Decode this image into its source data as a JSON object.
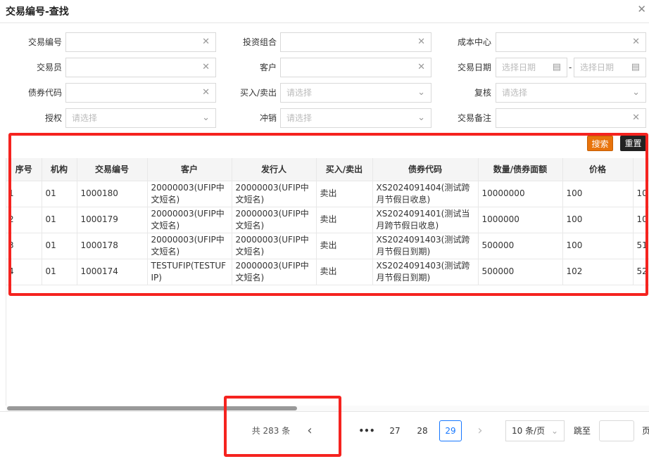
{
  "dialog": {
    "title": "交易编号-查找",
    "close_icon": "close-icon"
  },
  "form": {
    "trade_no": {
      "label": "交易编号",
      "value": ""
    },
    "portfolio": {
      "label": "投资组合",
      "value": ""
    },
    "cost_center": {
      "label": "成本中心",
      "value": ""
    },
    "trader": {
      "label": "交易员",
      "value": ""
    },
    "customer": {
      "label": "客户",
      "value": ""
    },
    "trade_date": {
      "label": "交易日期",
      "start_placeholder": "选择日期",
      "end_placeholder": "选择日期",
      "separator": "-"
    },
    "bond_code": {
      "label": "债券代码",
      "value": ""
    },
    "buy_sell": {
      "label": "买入/卖出",
      "placeholder": "请选择"
    },
    "review": {
      "label": "复核",
      "placeholder": "请选择"
    },
    "authorize": {
      "label": "授权",
      "placeholder": "请选择"
    },
    "offset": {
      "label": "冲销",
      "placeholder": "请选择"
    },
    "remark": {
      "label": "交易备注",
      "value": ""
    },
    "search_label": "搜索",
    "reset_label": "重置",
    "search_color": "#e8730c",
    "reset_color": "#222222"
  },
  "table": {
    "columns": [
      "序号",
      "机构",
      "交易编号",
      "客户",
      "发行人",
      "买入/卖出",
      "债券代码",
      "数量/债券面额",
      "价格",
      ""
    ],
    "rows": [
      [
        "1",
        "01",
        "1000180",
        "20000003(UFIP中文短名)",
        "20000003(UFIP中文短名)",
        "卖出",
        "XS2024091404(测试跨月节假日收息)",
        "10000000",
        "100",
        "10"
      ],
      [
        "2",
        "01",
        "1000179",
        "20000003(UFIP中文短名)",
        "20000003(UFIP中文短名)",
        "卖出",
        "XS2024091401(测试当月跨节假日收息)",
        "1000000",
        "100",
        "10"
      ],
      [
        "3",
        "01",
        "1000178",
        "20000003(UFIP中文短名)",
        "20000003(UFIP中文短名)",
        "卖出",
        "XS2024091403(测试跨月节假日到期)",
        "500000",
        "100",
        "51"
      ],
      [
        "4",
        "01",
        "1000174",
        "TESTUFIP(TESTUFIP)",
        "20000003(UFIP中文短名)",
        "卖出",
        "XS2024091403(测试跨月节假日到期)",
        "500000",
        "102",
        "52"
      ]
    ]
  },
  "pagination": {
    "total": "共 283 条",
    "ellipsis": "•••",
    "pages": [
      "27",
      "28",
      "29"
    ],
    "current": "29",
    "page_size": "10 条/页",
    "jump_label": "跳至",
    "page_suffix": "页",
    "active_color": "#1677ff"
  },
  "highlight_color": "#f5231f"
}
